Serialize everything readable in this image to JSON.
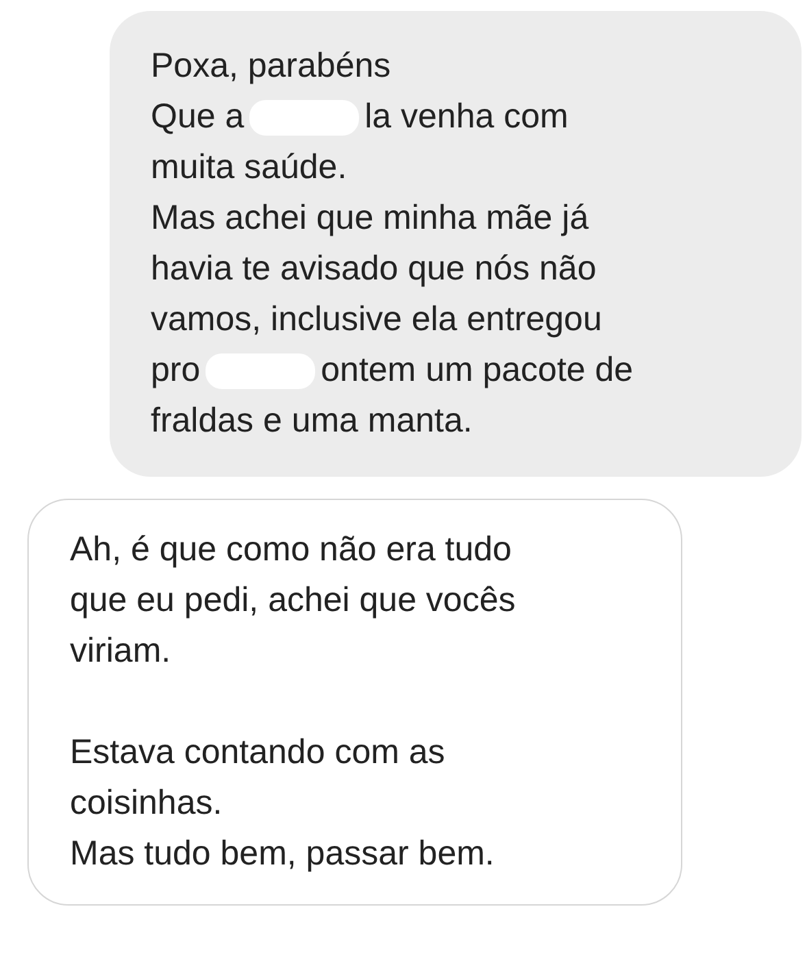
{
  "messages": [
    {
      "kind": "received",
      "paragraphs": [
        [
          {
            "parts": [
              {
                "kind": "text",
                "text": "Poxa, parabéns"
              }
            ]
          },
          {
            "parts": [
              {
                "kind": "text",
                "text": "Que a"
              },
              {
                "kind": "redacted"
              },
              {
                "kind": "text",
                "text": "la venha com"
              }
            ]
          },
          {
            "parts": [
              {
                "kind": "text",
                "text": "muita saúde."
              }
            ]
          },
          {
            "parts": [
              {
                "kind": "text",
                "text": "Mas achei que minha mãe já"
              }
            ]
          },
          {
            "parts": [
              {
                "kind": "text",
                "text": "havia te avisado que nós não"
              }
            ]
          },
          {
            "parts": [
              {
                "kind": "text",
                "text": "vamos, inclusive ela entregou"
              }
            ]
          },
          {
            "parts": [
              {
                "kind": "text",
                "text": "pro"
              },
              {
                "kind": "redacted"
              },
              {
                "kind": "text",
                "text": "ontem um pacote de"
              }
            ]
          },
          {
            "parts": [
              {
                "kind": "text",
                "text": "fraldas e uma manta."
              }
            ]
          }
        ]
      ]
    },
    {
      "kind": "sent",
      "paragraphs": [
        [
          {
            "parts": [
              {
                "kind": "text",
                "text": "Ah, é que como não era tudo"
              }
            ]
          },
          {
            "parts": [
              {
                "kind": "text",
                "text": "que eu pedi, achei que vocês"
              }
            ]
          },
          {
            "parts": [
              {
                "kind": "text",
                "text": "viriam."
              }
            ]
          }
        ],
        [
          {
            "parts": [
              {
                "kind": "text",
                "text": "Estava contando com as"
              }
            ]
          },
          {
            "parts": [
              {
                "kind": "text",
                "text": "coisinhas."
              }
            ]
          },
          {
            "parts": [
              {
                "kind": "text",
                "text": "Mas tudo bem, passar bem."
              }
            ]
          }
        ]
      ]
    }
  ]
}
